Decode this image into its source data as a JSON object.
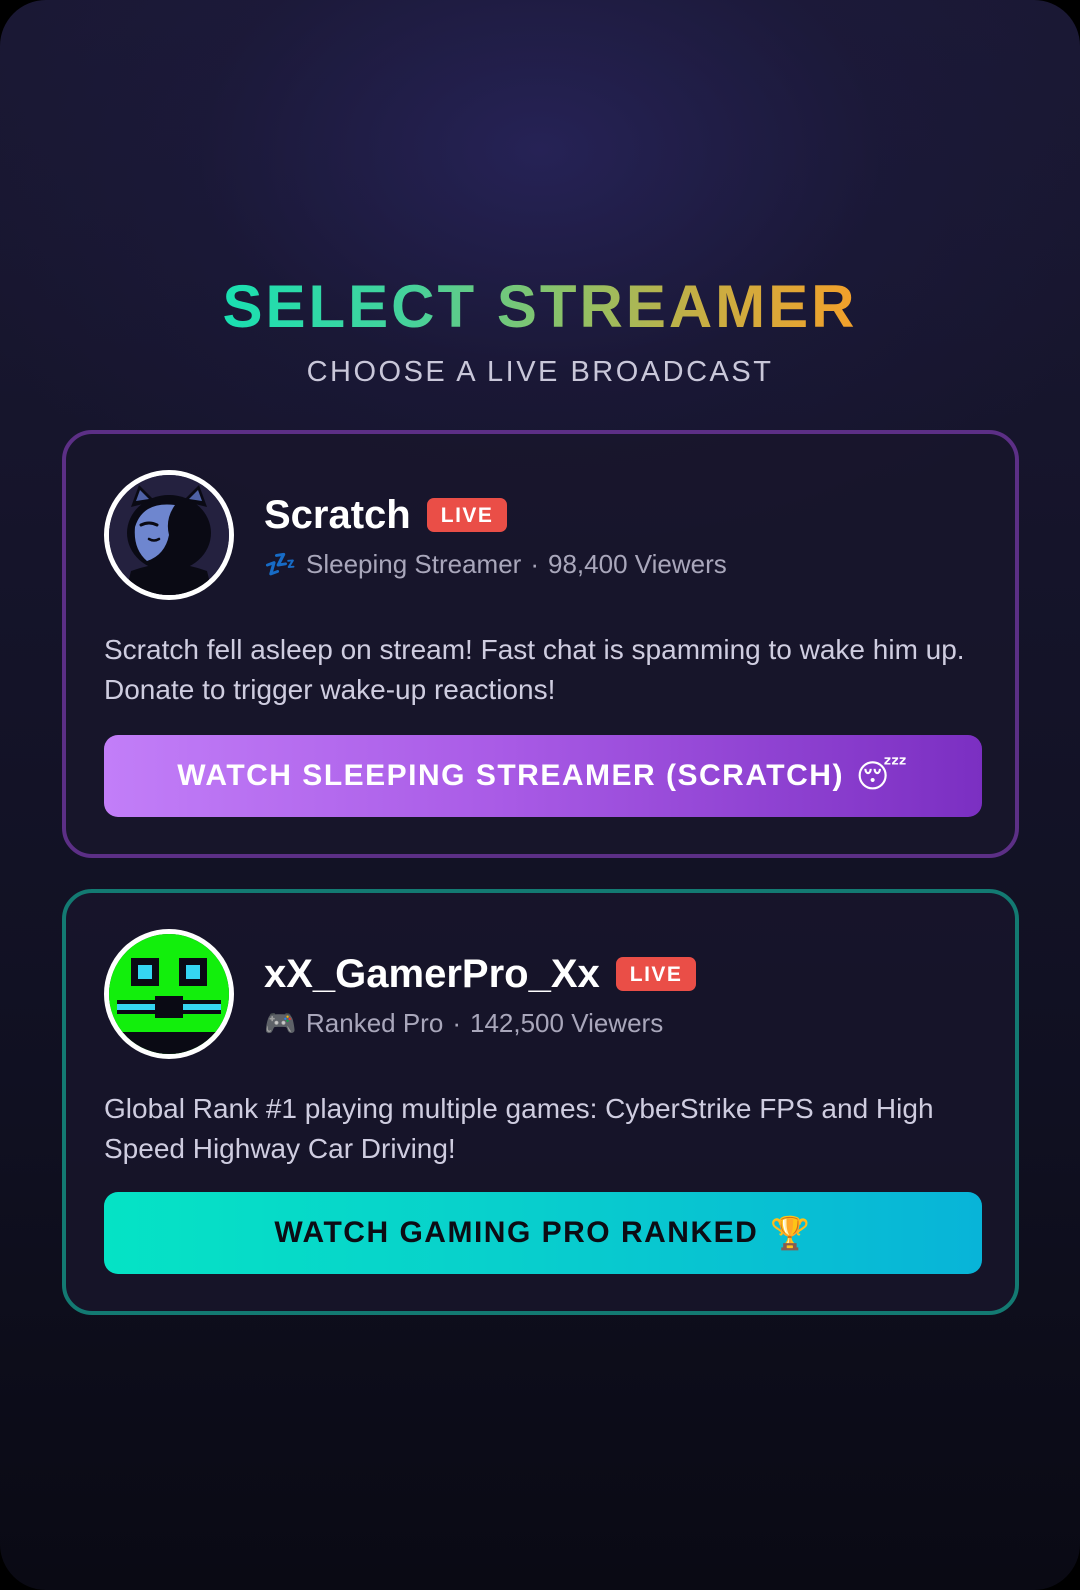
{
  "header": {
    "title": "SELECT STREAMER",
    "subtitle": "CHOOSE A LIVE BROADCAST"
  },
  "streamers": [
    {
      "name": "Scratch",
      "badge": "LIVE",
      "category_icon": "💤",
      "category_icon_name": "zzz-icon",
      "category": "Sleeping Streamer",
      "separator": "·",
      "viewers": "98,400 Viewers",
      "description": "Scratch fell asleep on stream! Fast chat is spamming to wake him up. Donate to trigger wake-up reactions!",
      "button_label": "WATCH SLEEPING STREAMER (SCRATCH)",
      "button_emoji": "😴",
      "accent_color": "#5c2f86"
    },
    {
      "name": "xX_GamerPro_Xx",
      "badge": "LIVE",
      "category_icon": "🎮",
      "category_icon_name": "gamepad-icon",
      "category": "Ranked Pro",
      "separator": "·",
      "viewers": "142,500 Viewers",
      "description": "Global Rank #1 playing multiple games: CyberStrike FPS and High Speed Highway Car Driving!",
      "button_label": "WATCH GAMING PRO RANKED",
      "button_emoji": "🏆",
      "accent_color": "#137a72"
    }
  ],
  "colors": {
    "live_badge": "#ea4e47",
    "title_gradient_start": "#19e0b2",
    "title_gradient_end": "#f3a02a"
  }
}
